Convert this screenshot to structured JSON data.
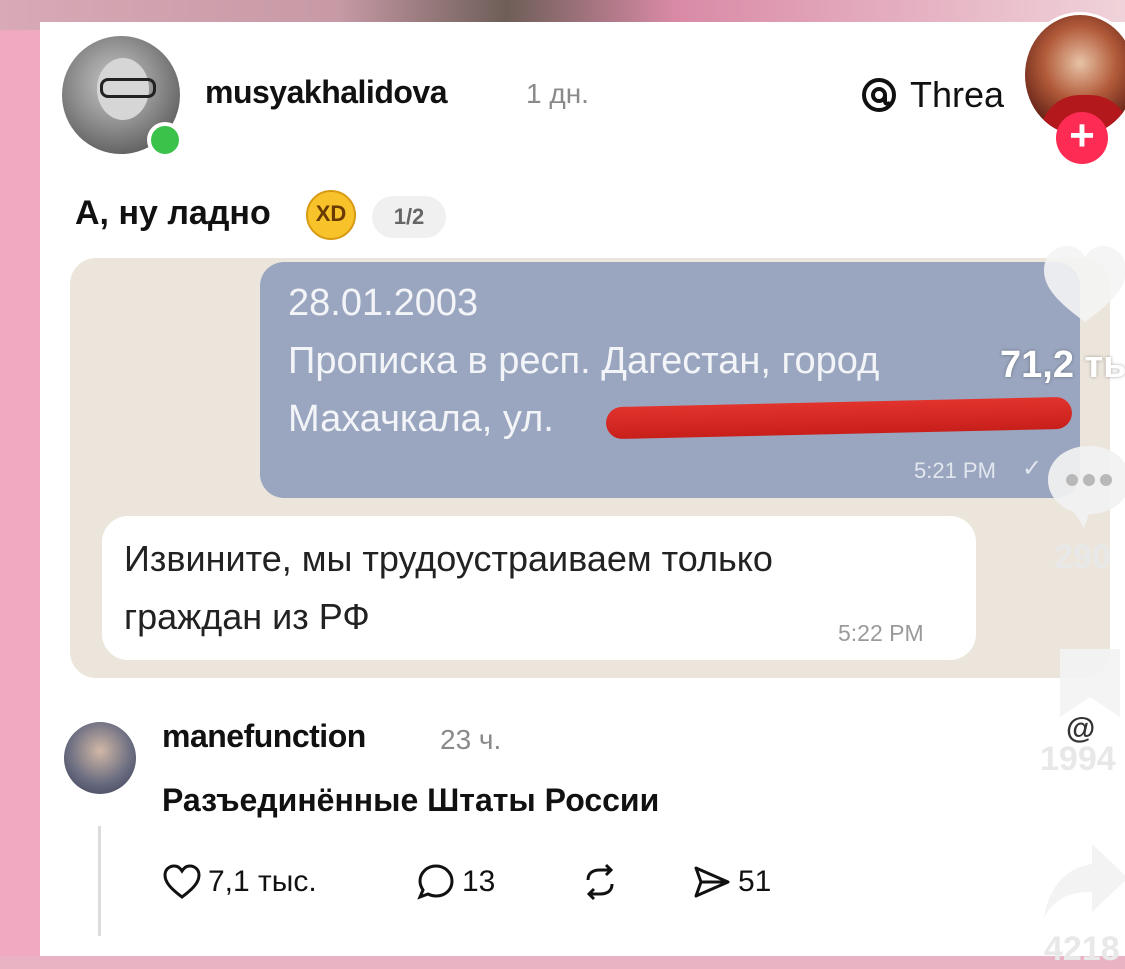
{
  "post": {
    "author": "musyakhalidova",
    "time": "1 дн.",
    "platform": "Threa",
    "text": "А, ну ладно",
    "emoji": "XD",
    "page_indicator": "1/2"
  },
  "chat": {
    "outgoing": {
      "line1": "28.01.2003",
      "line2": "Прописка в респ. Дагестан, город",
      "line3": "Махачкала, ул.",
      "time": "5:21 PM",
      "tick": "✓"
    },
    "incoming": {
      "line1": "Извините, мы трудоустраиваем только",
      "line2": "граждан из РФ",
      "time": "5:22 PM"
    }
  },
  "overlay_views": "71,2 ты",
  "reply": {
    "author": "manefunction",
    "time": "23 ч.",
    "text": "Разъединённые Штаты России",
    "likes": "7,1 тыс.",
    "comments": "13",
    "shares": "51"
  },
  "sidebar": {
    "comments_count": "290",
    "bookmarks_count": "1994",
    "shares_count": "4218",
    "follow_symbol": "+",
    "threads_mark": "@"
  },
  "colors": {
    "online": "#3bc24a",
    "follow": "#fe2c55",
    "chat_bg": "#ece5dc",
    "outgoing_bubble": "#9aa6bf",
    "redaction": "#e2332d"
  }
}
